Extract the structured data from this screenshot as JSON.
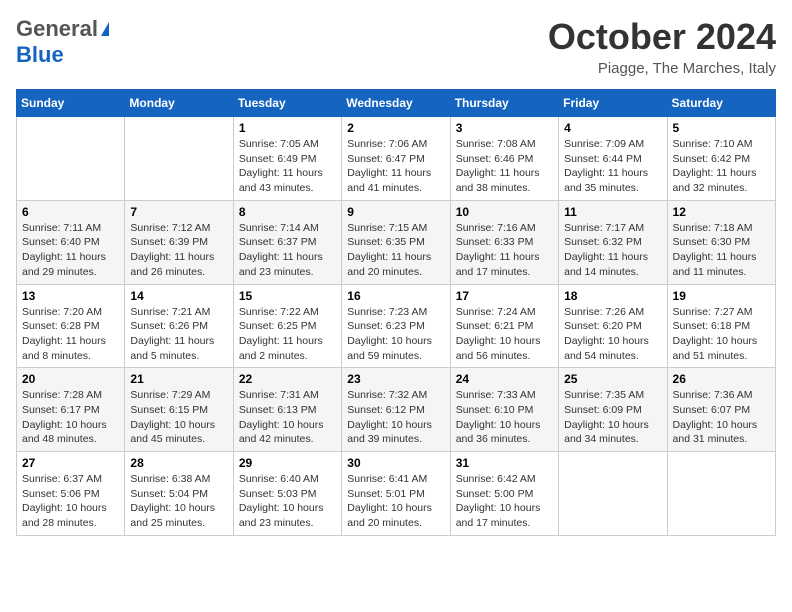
{
  "header": {
    "logo_general": "General",
    "logo_blue": "Blue",
    "month_title": "October 2024",
    "location": "Piagge, The Marches, Italy"
  },
  "weekdays": [
    "Sunday",
    "Monday",
    "Tuesday",
    "Wednesday",
    "Thursday",
    "Friday",
    "Saturday"
  ],
  "weeks": [
    [
      {
        "day": "",
        "info": ""
      },
      {
        "day": "",
        "info": ""
      },
      {
        "day": "1",
        "sunrise": "Sunrise: 7:05 AM",
        "sunset": "Sunset: 6:49 PM",
        "daylight": "Daylight: 11 hours and 43 minutes."
      },
      {
        "day": "2",
        "sunrise": "Sunrise: 7:06 AM",
        "sunset": "Sunset: 6:47 PM",
        "daylight": "Daylight: 11 hours and 41 minutes."
      },
      {
        "day": "3",
        "sunrise": "Sunrise: 7:08 AM",
        "sunset": "Sunset: 6:46 PM",
        "daylight": "Daylight: 11 hours and 38 minutes."
      },
      {
        "day": "4",
        "sunrise": "Sunrise: 7:09 AM",
        "sunset": "Sunset: 6:44 PM",
        "daylight": "Daylight: 11 hours and 35 minutes."
      },
      {
        "day": "5",
        "sunrise": "Sunrise: 7:10 AM",
        "sunset": "Sunset: 6:42 PM",
        "daylight": "Daylight: 11 hours and 32 minutes."
      }
    ],
    [
      {
        "day": "6",
        "sunrise": "Sunrise: 7:11 AM",
        "sunset": "Sunset: 6:40 PM",
        "daylight": "Daylight: 11 hours and 29 minutes."
      },
      {
        "day": "7",
        "sunrise": "Sunrise: 7:12 AM",
        "sunset": "Sunset: 6:39 PM",
        "daylight": "Daylight: 11 hours and 26 minutes."
      },
      {
        "day": "8",
        "sunrise": "Sunrise: 7:14 AM",
        "sunset": "Sunset: 6:37 PM",
        "daylight": "Daylight: 11 hours and 23 minutes."
      },
      {
        "day": "9",
        "sunrise": "Sunrise: 7:15 AM",
        "sunset": "Sunset: 6:35 PM",
        "daylight": "Daylight: 11 hours and 20 minutes."
      },
      {
        "day": "10",
        "sunrise": "Sunrise: 7:16 AM",
        "sunset": "Sunset: 6:33 PM",
        "daylight": "Daylight: 11 hours and 17 minutes."
      },
      {
        "day": "11",
        "sunrise": "Sunrise: 7:17 AM",
        "sunset": "Sunset: 6:32 PM",
        "daylight": "Daylight: 11 hours and 14 minutes."
      },
      {
        "day": "12",
        "sunrise": "Sunrise: 7:18 AM",
        "sunset": "Sunset: 6:30 PM",
        "daylight": "Daylight: 11 hours and 11 minutes."
      }
    ],
    [
      {
        "day": "13",
        "sunrise": "Sunrise: 7:20 AM",
        "sunset": "Sunset: 6:28 PM",
        "daylight": "Daylight: 11 hours and 8 minutes."
      },
      {
        "day": "14",
        "sunrise": "Sunrise: 7:21 AM",
        "sunset": "Sunset: 6:26 PM",
        "daylight": "Daylight: 11 hours and 5 minutes."
      },
      {
        "day": "15",
        "sunrise": "Sunrise: 7:22 AM",
        "sunset": "Sunset: 6:25 PM",
        "daylight": "Daylight: 11 hours and 2 minutes."
      },
      {
        "day": "16",
        "sunrise": "Sunrise: 7:23 AM",
        "sunset": "Sunset: 6:23 PM",
        "daylight": "Daylight: 10 hours and 59 minutes."
      },
      {
        "day": "17",
        "sunrise": "Sunrise: 7:24 AM",
        "sunset": "Sunset: 6:21 PM",
        "daylight": "Daylight: 10 hours and 56 minutes."
      },
      {
        "day": "18",
        "sunrise": "Sunrise: 7:26 AM",
        "sunset": "Sunset: 6:20 PM",
        "daylight": "Daylight: 10 hours and 54 minutes."
      },
      {
        "day": "19",
        "sunrise": "Sunrise: 7:27 AM",
        "sunset": "Sunset: 6:18 PM",
        "daylight": "Daylight: 10 hours and 51 minutes."
      }
    ],
    [
      {
        "day": "20",
        "sunrise": "Sunrise: 7:28 AM",
        "sunset": "Sunset: 6:17 PM",
        "daylight": "Daylight: 10 hours and 48 minutes."
      },
      {
        "day": "21",
        "sunrise": "Sunrise: 7:29 AM",
        "sunset": "Sunset: 6:15 PM",
        "daylight": "Daylight: 10 hours and 45 minutes."
      },
      {
        "day": "22",
        "sunrise": "Sunrise: 7:31 AM",
        "sunset": "Sunset: 6:13 PM",
        "daylight": "Daylight: 10 hours and 42 minutes."
      },
      {
        "day": "23",
        "sunrise": "Sunrise: 7:32 AM",
        "sunset": "Sunset: 6:12 PM",
        "daylight": "Daylight: 10 hours and 39 minutes."
      },
      {
        "day": "24",
        "sunrise": "Sunrise: 7:33 AM",
        "sunset": "Sunset: 6:10 PM",
        "daylight": "Daylight: 10 hours and 36 minutes."
      },
      {
        "day": "25",
        "sunrise": "Sunrise: 7:35 AM",
        "sunset": "Sunset: 6:09 PM",
        "daylight": "Daylight: 10 hours and 34 minutes."
      },
      {
        "day": "26",
        "sunrise": "Sunrise: 7:36 AM",
        "sunset": "Sunset: 6:07 PM",
        "daylight": "Daylight: 10 hours and 31 minutes."
      }
    ],
    [
      {
        "day": "27",
        "sunrise": "Sunrise: 6:37 AM",
        "sunset": "Sunset: 5:06 PM",
        "daylight": "Daylight: 10 hours and 28 minutes."
      },
      {
        "day": "28",
        "sunrise": "Sunrise: 6:38 AM",
        "sunset": "Sunset: 5:04 PM",
        "daylight": "Daylight: 10 hours and 25 minutes."
      },
      {
        "day": "29",
        "sunrise": "Sunrise: 6:40 AM",
        "sunset": "Sunset: 5:03 PM",
        "daylight": "Daylight: 10 hours and 23 minutes."
      },
      {
        "day": "30",
        "sunrise": "Sunrise: 6:41 AM",
        "sunset": "Sunset: 5:01 PM",
        "daylight": "Daylight: 10 hours and 20 minutes."
      },
      {
        "day": "31",
        "sunrise": "Sunrise: 6:42 AM",
        "sunset": "Sunset: 5:00 PM",
        "daylight": "Daylight: 10 hours and 17 minutes."
      },
      {
        "day": "",
        "info": ""
      },
      {
        "day": "",
        "info": ""
      }
    ]
  ]
}
